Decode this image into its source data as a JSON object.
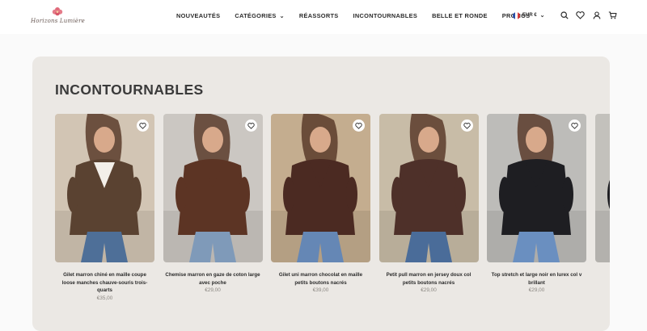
{
  "brand": {
    "logo_text": "Horizons Lumière"
  },
  "nav": {
    "items": [
      {
        "label": "NOUVEAUTÉS",
        "dropdown": false
      },
      {
        "label": "CATÉGORIES",
        "dropdown": true
      },
      {
        "label": "RÉASSORTS",
        "dropdown": false
      },
      {
        "label": "INCONTOURNABLES",
        "dropdown": false
      },
      {
        "label": "BELLE ET RONDE",
        "dropdown": false
      },
      {
        "label": "PROMOS",
        "dropdown": false
      }
    ]
  },
  "header_tools": {
    "currency_label": "EUR €",
    "icons": [
      "search-icon",
      "heart-icon",
      "account-icon",
      "cart-icon"
    ]
  },
  "section": {
    "title": "INCONTOURNABLES"
  },
  "products": [
    {
      "title": "Gilet marron chiné en maille coupe loose manches chauve-souris trois-quarts",
      "price": "€35,00",
      "garment": "#5a4231",
      "pants": "#4e6f98",
      "bg": "#d2c5b4",
      "top": "#f3efe9"
    },
    {
      "title": "Chemise marron en gaze de coton large avec poche",
      "price": "€29,00",
      "garment": "#5c3424",
      "pants": "#7f9ab9",
      "bg": "#cbc7c2",
      "top": "#5c3424"
    },
    {
      "title": "Gilet uni marron chocolat en maille petits boutons nacrés",
      "price": "€39,00",
      "garment": "#4b2a22",
      "pants": "#6587b5",
      "bg": "#c4ad8f",
      "top": "#4b2a22"
    },
    {
      "title": "Petit pull marron en jersey doux col petits boutons nacrés",
      "price": "€29,00",
      "garment": "#4e3029",
      "pants": "#4a6c99",
      "bg": "#c8bca7",
      "top": "#4e3029"
    },
    {
      "title": "Top stretch et large noir en lurex col v brillant",
      "price": "€29,00",
      "garment": "#1e1e22",
      "pants": "#6a8fc0",
      "bg": "#bdbcb9",
      "top": "#1e1e22"
    },
    {
      "title": "G",
      "price": "",
      "garment": "#1e1e22",
      "pants": "#6a8fc0",
      "bg": "#c3c1bc",
      "top": "#1e1e22"
    }
  ],
  "colors": {
    "accent": "#2b2b2b",
    "panel": "#ebe8e4",
    "price": "#8a8681"
  }
}
